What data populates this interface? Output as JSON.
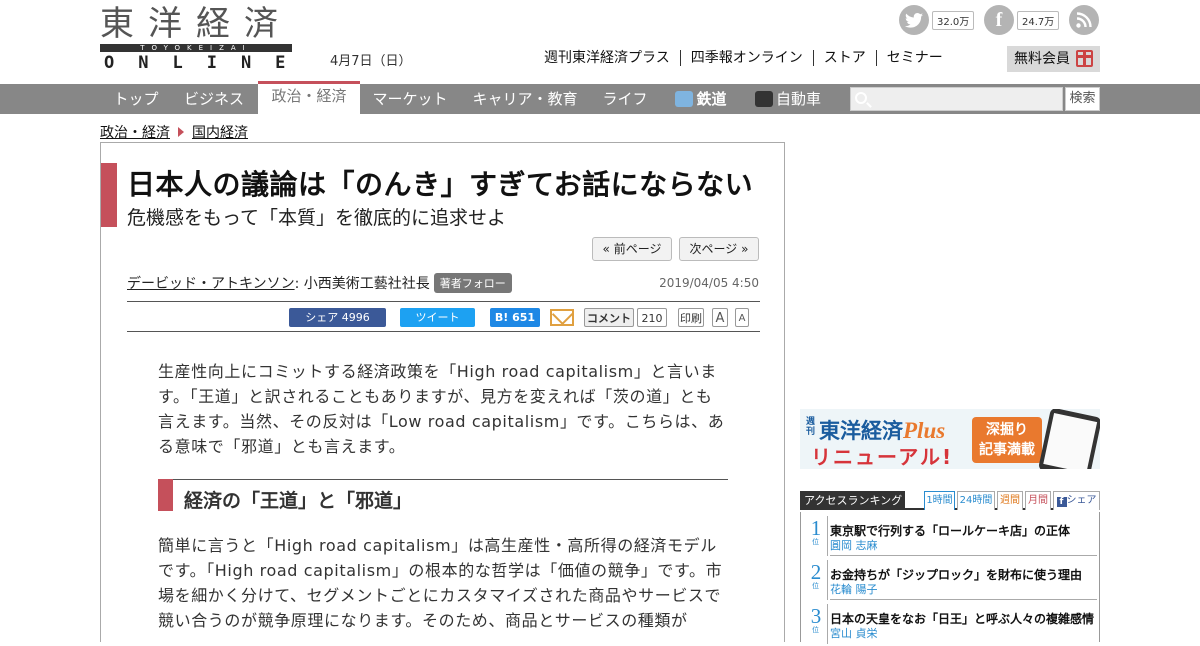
{
  "logo": {
    "kanji": "東洋経済",
    "romaji": "TOYOKEIZAI",
    "online": "ONLINE"
  },
  "header": {
    "date": "4月7日（日）",
    "social": {
      "twitter_count": "32.0万",
      "facebook_count": "24.7万"
    },
    "nav_links": [
      "週刊東洋経済プラス",
      "四季報オンライン",
      "ストア",
      "セミナー"
    ],
    "free_member": "無料会員"
  },
  "category_nav": {
    "items": [
      "トップ",
      "ビジネス",
      "政治・経済",
      "マーケット",
      "キャリア・教育",
      "ライフ",
      "鉄道",
      "自動車"
    ],
    "active": "政治・経済",
    "search_button": "検索"
  },
  "breadcrumb": [
    "政治・経済",
    "国内経済"
  ],
  "article": {
    "title": "日本人の議論は「のんき」すぎてお話にならない",
    "subtitle": "危機感をもって「本質」を徹底的に追求せよ",
    "prev_page": "« 前ページ",
    "next_page": "次ページ »",
    "author_name": "デービッド・アトキンソン",
    "author_title": " : 小西美術工藝社社長",
    "follow_label": "著者フォロー",
    "published": "2019/04/05 4:50",
    "share": {
      "facebook": "シェア 4996",
      "tweet": "ツイート",
      "hatena": "B! 651",
      "comment": "コメント",
      "comment_count": "210",
      "print": "印刷",
      "font_large": "A",
      "font_small": "A"
    },
    "paragraph1": "生産性向上にコミットする経済政策を「High road capitalism」と言います。「王道」と訳されることもありますが、見方を変えれば「茨の道」とも言えます。当然、その反対は「Low road capitalism」です。こちらは、ある意味で「邪道」とも言えます。",
    "section_heading": "経済の「王道」と「邪道」",
    "paragraph2": "簡単に言うと「High road capitalism」は高生産性・高所得の経済モデルです。「High road capitalism」の根本的な哲学は「価値の競争」です。市場を細かく分けて、セグメントごとにカスタマイズされた商品やサービスで競い合うのが競争原理になります。そのため、商品とサービスの種類が"
  },
  "promo": {
    "weekly": "週刊",
    "brand": "東洋経済",
    "brand_plus": "Plus",
    "renewal": "リニューアル!",
    "tag": "深掘り\n記事満載"
  },
  "ranking": {
    "title": "アクセスランキング",
    "tabs": [
      "1時間",
      "24時間",
      "週間",
      "月間",
      "シェア"
    ],
    "rank_unit": "位",
    "items": [
      {
        "rank": "1",
        "title": "東京駅で行列する「ロールケーキ店」の正体",
        "author": "圓岡 志麻"
      },
      {
        "rank": "2",
        "title": "お金持ちが「ジップロック」を財布に使う理由",
        "author": "花輪 陽子"
      },
      {
        "rank": "3",
        "title": "日本の天皇をなお「日王」と呼ぶ人々の複雑感情",
        "author": "宮山 貞栄"
      }
    ]
  },
  "colors": {
    "accent": "#c5505b",
    "nav_bg": "#878787",
    "link_blue": "#2a8ccf",
    "facebook": "#3b5998",
    "twitter": "#1da1f2"
  }
}
